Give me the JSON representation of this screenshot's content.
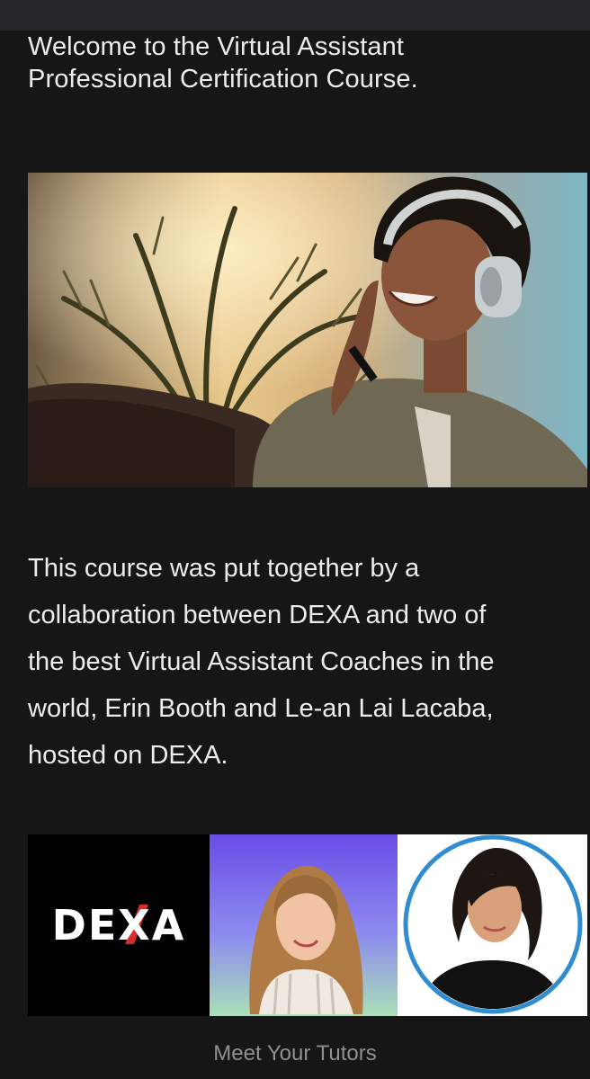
{
  "welcome": {
    "line1": "Welcome to the Virtual Assistant",
    "line2": "Professional Certification Course."
  },
  "hero": {
    "alt": "Smiling woman wearing headphones next to a plant"
  },
  "intro": {
    "line1": "This course was put together by a",
    "line2": "collaboration between DEXA and two of",
    "line3": "the best Virtual Assistant Coaches in the",
    "line4": "world, Erin Booth and Le-an Lai Lacaba,",
    "line5": "hosted on DEXA."
  },
  "tutors": {
    "logo_text_left": "DE",
    "logo_text_x": "X",
    "logo_text_right": "A",
    "caption": "Meet Your Tutors"
  },
  "colors": {
    "background": "#161617",
    "text": "#ececec",
    "caption": "#8f9093",
    "dexa_red": "#d62b2b",
    "circle_blue": "#2f8ccf"
  }
}
